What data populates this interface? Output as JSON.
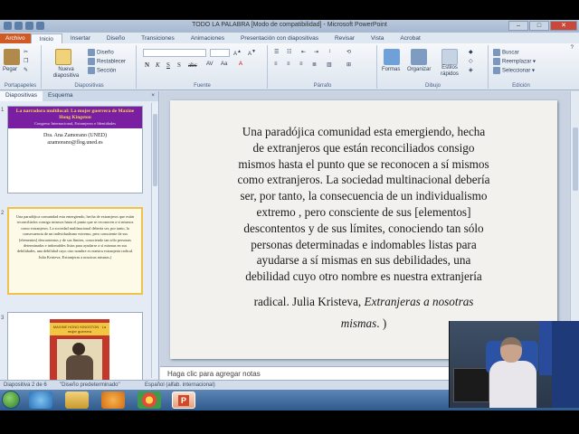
{
  "window": {
    "title": "TODO LA PALABRA [Modo de compatibilidad] - Microsoft PowerPoint",
    "min_label": "–",
    "max_label": "□",
    "close_label": "✕"
  },
  "tabs": [
    {
      "label": "Archivo"
    },
    {
      "label": "Inicio"
    },
    {
      "label": "Insertar"
    },
    {
      "label": "Diseño"
    },
    {
      "label": "Transiciones"
    },
    {
      "label": "Animaciones"
    },
    {
      "label": "Presentación con diapositivas"
    },
    {
      "label": "Revisar"
    },
    {
      "label": "Vista"
    },
    {
      "label": "Acrobat"
    }
  ],
  "ribbon": {
    "clipboard": {
      "paste_label": "Pegar",
      "group_label": "Portapapeles"
    },
    "slides": {
      "new_slide_label": "Nueva diapositiva",
      "layout_label": "Diseño",
      "reset_label": "Restablecer",
      "section_label": "Sección",
      "group_label": "Diapositivas"
    },
    "font": {
      "group_label": "Fuente",
      "bold": "N",
      "italic": "K",
      "underline": "S",
      "strike": "abc",
      "shadow": "S"
    },
    "paragraph": {
      "group_label": "Párrafo"
    },
    "drawing": {
      "shapes_label": "Formas",
      "arrange_label": "Organizar",
      "quick_styles_label": "Estilos rápidos",
      "group_label": "Dibujo"
    },
    "editing": {
      "find_label": "Buscar",
      "replace_label": "Reemplazar",
      "select_label": "Seleccionar",
      "group_label": "Edición"
    }
  },
  "left_pane": {
    "tab_slides": "Diapositivas",
    "tab_outline": "Esquema",
    "close_label": "×",
    "slides": [
      {
        "number": "1",
        "title": "La narradora multilocal: La mujer guerrera de Maxine Hong Kingston",
        "subtitle": "Congreso Internacional, Extranjeros e Identidades",
        "author": "Dra. Ana Zamorano (UNED)",
        "email": "azamorano@flog.uned.es"
      },
      {
        "number": "2",
        "text": "Una paradójica comunidad esta emergiendo, hecha de extranjeros que están reconciliados consigo mismos hasta el punto que se reconocen a sí mismos como extranjeros. La sociedad multinacional debería ser, por tanto, la consecuencia de un individualismo extremo, pero consciente de sus [elementos] descontentos y de sus límites, conociendo tan sólo personas determinadas e indomables listas para ayudarse a sí mismas en sus debilidades, una debilidad cuyo otro nombre es nuestra extranjería radical. Julia Kristeva, Extranjeras a nosotras mismas.)"
      },
      {
        "number": "3",
        "cover_band": "MAXINE HONG KINGSTON · La mujer guerrera"
      }
    ]
  },
  "slide": {
    "lines": [
      "Una paradójica comunidad esta emergiendo, hecha",
      "de extranjeros que están reconciliados  consigo",
      "mismos hasta el punto que se reconocen a sí mismos",
      "como extranjeros. La sociedad multinacional  debería",
      "ser, por tanto, la consecuencia de un individualismo",
      "extremo , pero consciente de sus [elementos]",
      "descontentos y de sus límites, conociendo tan sólo",
      "personas determinadas e indomables listas para",
      "ayudarse a sí mismas en sus debilidades,  una",
      "debilidad  cuyo otro nombre es nuestra extranjería"
    ],
    "last_line_plain": "radical.  Julia Kristeva, ",
    "last_line_italic": "Extranjeras a nosotras",
    "final_italic": "mismas",
    "final_plain": ". )"
  },
  "notes_placeholder": "Haga clic para agregar notas",
  "status": {
    "slide_of": "Diapositiva 2 de 6",
    "theme": "\"Diseño predeterminado\"",
    "language": "Español (alfab. internacional)"
  },
  "taskbar": {
    "apps": [
      "start",
      "internet-explorer",
      "file-explorer",
      "media-player",
      "chrome",
      "powerpoint"
    ]
  },
  "colors": {
    "file_tab": "#d05a26",
    "slide1_band": "#7b1fa2",
    "slide1_title": "#f5d84a",
    "taskbar": "#2f5a8c"
  }
}
